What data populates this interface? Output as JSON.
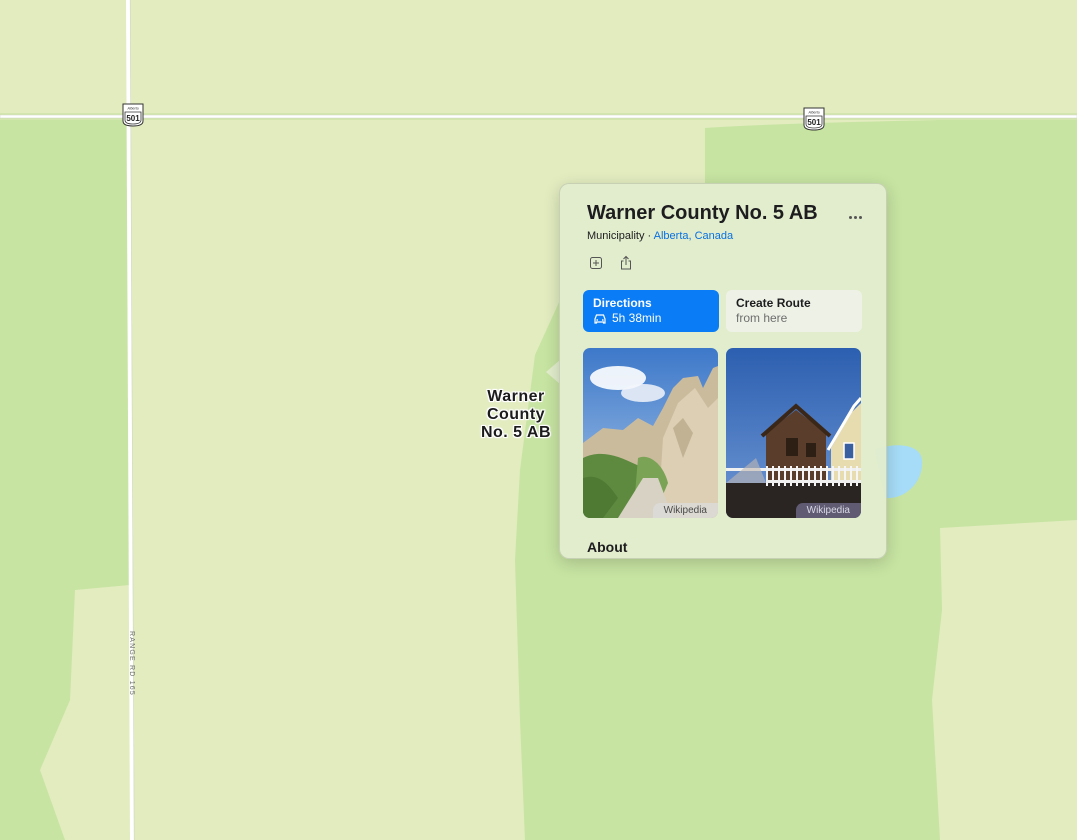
{
  "map": {
    "highway_shields": [
      {
        "number": "501",
        "label": "Alberta"
      },
      {
        "number": "501",
        "label": "Alberta"
      }
    ],
    "road_labels": [
      "RANGE RD 165"
    ],
    "place_label": [
      "Warner",
      "County",
      "No. 5 AB"
    ],
    "colors": {
      "land_light": "#e2ecbf",
      "land_green": "#c7e4a2",
      "water": "#a6dcf7",
      "road": "#ffffff"
    }
  },
  "card": {
    "title": "Warner County No. 5 AB",
    "category": "Municipality",
    "separator": " · ",
    "location_link": "Alberta, Canada",
    "icons": [
      "add-to-guide-icon",
      "share-icon",
      "more-icon",
      "car-icon"
    ],
    "directions": {
      "label": "Directions",
      "travel_time": "5h 38min"
    },
    "create_route": {
      "label": "Create Route",
      "sublabel": "from here"
    },
    "photos": [
      {
        "source": "Wikipedia"
      },
      {
        "source": "Wikipedia"
      }
    ],
    "about_heading": "About",
    "accent_color": "#0a7cf5"
  }
}
